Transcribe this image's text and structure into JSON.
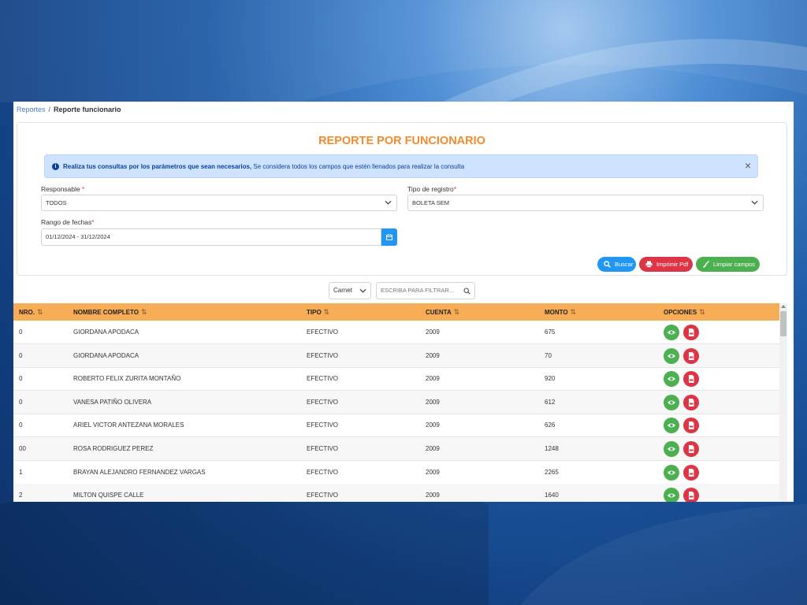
{
  "breadcrumb": {
    "parent": "Reportes",
    "separator": "/",
    "current": "Reporte funcionario"
  },
  "title": "REPORTE POR FUNCIONARIO",
  "alert": {
    "bold": "Realiza tus consultas por los parámetros que sean necesarios,",
    "text": " Se considera todos los campos que estén llenados para realizar la consulta",
    "close": "×"
  },
  "form": {
    "responsable_label": "Responsable",
    "responsable_value": "TODOS",
    "tipo_label": "Tipo de registro",
    "tipo_value": "BOLETA SEM",
    "rango_label": "Rango de fechas",
    "rango_value": "01/12/2024 - 31/12/2024",
    "required_mark": "*"
  },
  "buttons": {
    "buscar": "Buscar",
    "imprimir": "Imprimir Pdf",
    "limpiar": "Limpiar campos"
  },
  "filter": {
    "select_value": "Carnet",
    "placeholder": "ESCRIBA PARA FILTRAR..."
  },
  "table": {
    "sort_glyph": "⇅",
    "headers": [
      "NRO.",
      "NOMBRE COMPLETO",
      "TIPO",
      "CUENTA",
      "MONTO",
      "OPCIONES"
    ],
    "rows": [
      {
        "nro": "0",
        "nombre": "GIORDANA APODACA",
        "tipo": "EFECTIVO",
        "cuenta": "2009",
        "monto": "675"
      },
      {
        "nro": "0",
        "nombre": "GIORDANA APODACA",
        "tipo": "EFECTIVO",
        "cuenta": "2009",
        "monto": "70"
      },
      {
        "nro": "0",
        "nombre": "ROBERTO FELIX ZURITA MONTAÑO",
        "tipo": "EFECTIVO",
        "cuenta": "2009",
        "monto": "920"
      },
      {
        "nro": "0",
        "nombre": "VANESA PATIÑO OLIVERA",
        "tipo": "EFECTIVO",
        "cuenta": "2009",
        "monto": "612"
      },
      {
        "nro": "0",
        "nombre": "ARIEL VICTOR ANTEZANA MORALES",
        "tipo": "EFECTIVO",
        "cuenta": "2009",
        "monto": "626"
      },
      {
        "nro": "00",
        "nombre": "ROSA RODRIGUEZ PEREZ",
        "tipo": "EFECTIVO",
        "cuenta": "2009",
        "monto": "1248"
      },
      {
        "nro": "1",
        "nombre": "BRAYAN ALEJANDRO FERNANDEZ VARGAS",
        "tipo": "EFECTIVO",
        "cuenta": "2009",
        "monto": "2265"
      },
      {
        "nro": "2",
        "nombre": "MILTON QUISPE CALLE",
        "tipo": "EFECTIVO",
        "cuenta": "2009",
        "monto": "1640"
      }
    ]
  },
  "colors": {
    "accent_title": "#f28b2c",
    "header_bg": "#f6ad55",
    "primary": "#2196f3",
    "danger": "#dc3545",
    "success": "#4caf50"
  },
  "icons": [
    "info-icon",
    "close-icon",
    "chevron-down-icon",
    "calendar-icon",
    "search-icon",
    "printer-icon",
    "broom-icon",
    "sort-icon",
    "eye-icon",
    "pdf-icon"
  ]
}
